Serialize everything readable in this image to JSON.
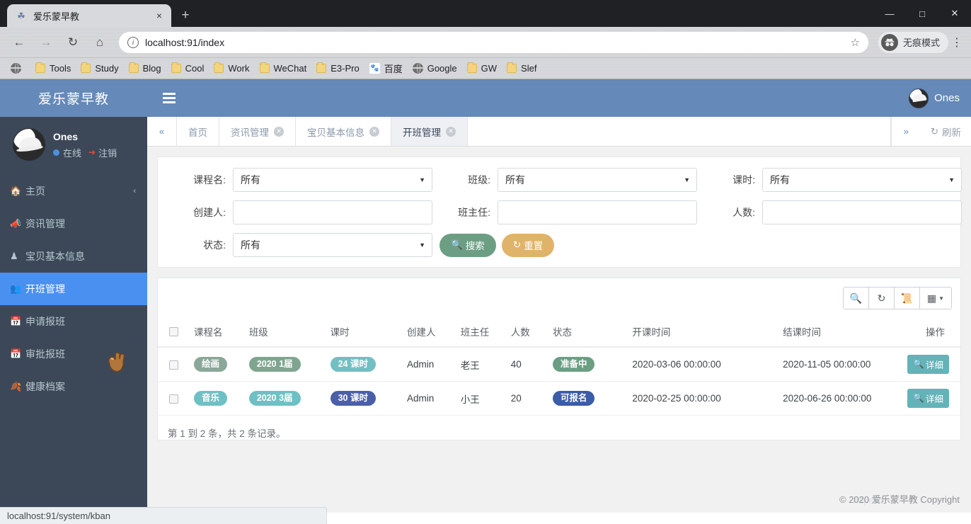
{
  "browser": {
    "tab": {
      "title": "爱乐蒙早教",
      "favicon": "leaf-icon",
      "close": "×"
    },
    "newtab_label": "+",
    "window": {
      "minimize": "—",
      "maximize": "□",
      "close": "✕"
    },
    "nav": {
      "back": "←",
      "forward": "→",
      "reload": "↻",
      "home": "⌂"
    },
    "omnibox": {
      "info": "i",
      "url": "localhost:91/index",
      "star": "☆"
    },
    "incognito_label": "无痕模式",
    "menu": "⋮",
    "bookmarks": [
      {
        "label": "Tools",
        "icon": "folder-icon"
      },
      {
        "label": "Study",
        "icon": "folder-icon"
      },
      {
        "label": "Blog",
        "icon": "folder-icon"
      },
      {
        "label": "Cool",
        "icon": "folder-icon"
      },
      {
        "label": "Work",
        "icon": "folder-icon"
      },
      {
        "label": "WeChat",
        "icon": "folder-icon"
      },
      {
        "label": "E3-Pro",
        "icon": "folder-icon"
      },
      {
        "label": "百度",
        "icon": "baidu-icon"
      },
      {
        "label": "Google",
        "icon": "globe-icon"
      },
      {
        "label": "GW",
        "icon": "folder-icon"
      },
      {
        "label": "Slef",
        "icon": "folder-icon"
      }
    ],
    "status_link": "localhost:91/system/kban"
  },
  "sidebar": {
    "brand": "爱乐蒙早教",
    "user": {
      "name": "Ones",
      "status": "在线",
      "logout": "注销"
    },
    "items": [
      {
        "label": "主页",
        "icon": "home-icon",
        "arrow": "‹",
        "active": false
      },
      {
        "label": "资讯管理",
        "icon": "megaphone-icon",
        "active": false
      },
      {
        "label": "宝贝基本信息",
        "icon": "child-icon",
        "active": false
      },
      {
        "label": "开班管理",
        "icon": "users-icon",
        "active": true
      },
      {
        "label": "申请报班",
        "icon": "calendar-icon",
        "active": false
      },
      {
        "label": "审批报班",
        "icon": "calendar-check-icon",
        "active": false
      },
      {
        "label": "健康档案",
        "icon": "leaf-icon",
        "active": false
      }
    ]
  },
  "topbar": {
    "hamburger": "menu-icon",
    "user_name": "Ones"
  },
  "tabs": {
    "prev_icon": "«",
    "next_icon": "»",
    "refresh_label": "刷新",
    "refresh_icon": "↻",
    "items": [
      {
        "label": "首页",
        "closable": false,
        "active": false
      },
      {
        "label": "资讯管理",
        "closable": true,
        "active": false
      },
      {
        "label": "宝贝基本信息",
        "closable": true,
        "active": false
      },
      {
        "label": "开班管理",
        "closable": true,
        "active": true
      }
    ]
  },
  "filter": {
    "fields": [
      {
        "label": "课程名:",
        "type": "select",
        "value": "所有"
      },
      {
        "label": "班级:",
        "type": "select",
        "value": "所有"
      },
      {
        "label": "课时:",
        "type": "select",
        "value": "所有"
      },
      {
        "label": "创建人:",
        "type": "input",
        "value": "",
        "placeholder": ""
      },
      {
        "label": "班主任:",
        "type": "input",
        "value": "",
        "placeholder": ""
      },
      {
        "label": "人数:",
        "type": "input",
        "value": "",
        "placeholder": ""
      },
      {
        "label": "状态:",
        "type": "select",
        "value": "所有"
      }
    ],
    "search_label": "搜索",
    "search_icon": "search-icon",
    "reset_label": "重置",
    "reset_icon": "refresh-icon"
  },
  "table": {
    "tools": [
      {
        "name": "search-icon",
        "glyph": "⌕"
      },
      {
        "name": "refresh-icon",
        "glyph": "↻"
      },
      {
        "name": "toggle-view-icon",
        "glyph": "▤"
      },
      {
        "name": "columns-icon",
        "glyph": "☷"
      }
    ],
    "columns": [
      "",
      "课程名",
      "班级",
      "课时",
      "创建人",
      "班主任",
      "人数",
      "状态",
      "开课时间",
      "结课时间",
      "操作"
    ],
    "rows": [
      {
        "course": "绘画",
        "course_color": "#8aa79a",
        "class": "2020 1届",
        "class_color": "#7fa58f",
        "hours": "24 课时",
        "hours_color": "#72bfc2",
        "creator": "Admin",
        "teacher": "老王",
        "count": "40",
        "status": "准备中",
        "status_color": "#6c9e84",
        "start": "2020-03-06 00:00:00",
        "end": "2020-11-05 00:00:00",
        "action": "详细"
      },
      {
        "course": "音乐",
        "course_color": "#6fc0c4",
        "class": "2020 3届",
        "class_color": "#6fc0c4",
        "hours": "30 课时",
        "hours_color": "#4a5fa8",
        "creator": "Admin",
        "teacher": "小王",
        "count": "20",
        "status": "可报名",
        "status_color": "#3b5ca8",
        "start": "2020-02-25 00:00:00",
        "end": "2020-06-26 00:00:00",
        "action": "详细"
      }
    ],
    "summary": "第 1 到 2 条，共 2 条记录。",
    "action_icon": "search-icon"
  },
  "footer": {
    "copyright": "© 2020 爱乐蒙早教 Copyright",
    "ghost": "https://b"
  },
  "colors": {
    "brand_blue": "#6589b8",
    "sidebar_dark": "#3c4858",
    "active_blue": "#4a90f0",
    "search_green": "#6c9e84",
    "reset_gold": "#e0b36a",
    "detail_teal": "#63b3b8"
  }
}
